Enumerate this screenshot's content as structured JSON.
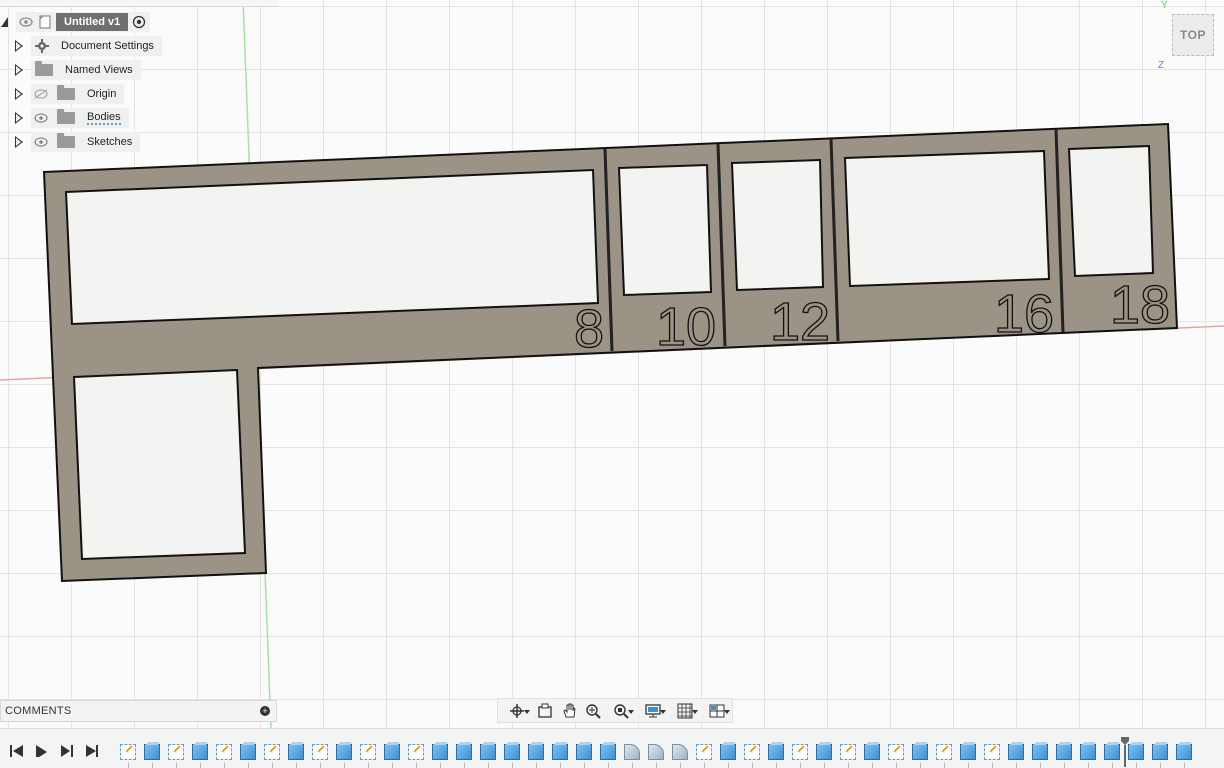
{
  "browser": {
    "document_title": "Untitled v1",
    "items": [
      {
        "label": "Document Settings",
        "icon": "gear-icon"
      },
      {
        "label": "Named Views",
        "icon": "folder-icon"
      },
      {
        "label": "Origin",
        "icon": "folder-icon",
        "visibility": "hidden"
      },
      {
        "label": "Bodies",
        "icon": "folder-icon",
        "visibility": "visible"
      },
      {
        "label": "Sketches",
        "icon": "folder-icon",
        "visibility": "visible"
      }
    ]
  },
  "viewcube": {
    "face": "TOP",
    "axis_y": "Y",
    "axis_z": "Z"
  },
  "model": {
    "labels": [
      "8",
      "10",
      "12",
      "16",
      "18"
    ]
  },
  "comments": {
    "label": "COMMENTS"
  },
  "navbar": {
    "tools": [
      "orbit-tool-icon",
      "look-at-icon",
      "pan-icon",
      "zoom-icon",
      "fit-icon",
      "display-settings-icon",
      "grid-settings-icon",
      "viewports-icon"
    ]
  },
  "timeline": {
    "controls": [
      "skip-to-start-icon",
      "play-icon",
      "step-forward-icon",
      "skip-to-end-icon"
    ],
    "features": [
      "sketch",
      "cube",
      "sketch",
      "cube",
      "sketch",
      "cube",
      "sketch",
      "cube",
      "sketch",
      "cube",
      "sketch",
      "cube",
      "sketch",
      "cube",
      "cube",
      "cube",
      "cube",
      "cube",
      "cube",
      "cube",
      "cube",
      "fillet",
      "fillet",
      "fillet",
      "sketch",
      "cube",
      "sketch",
      "cube",
      "sketch",
      "cube",
      "sketch",
      "cube",
      "sketch",
      "cube",
      "sketch",
      "cube",
      "sketch",
      "cube",
      "cube",
      "cube",
      "cube",
      "cube",
      "cube",
      "cube",
      "cube"
    ]
  },
  "colors": {
    "plate": "#9b9385",
    "grid": "#e4e4e4",
    "axis_red": "#d9534f",
    "axis_green": "#6ecf72",
    "accent_blue": "#3a8fd6"
  }
}
